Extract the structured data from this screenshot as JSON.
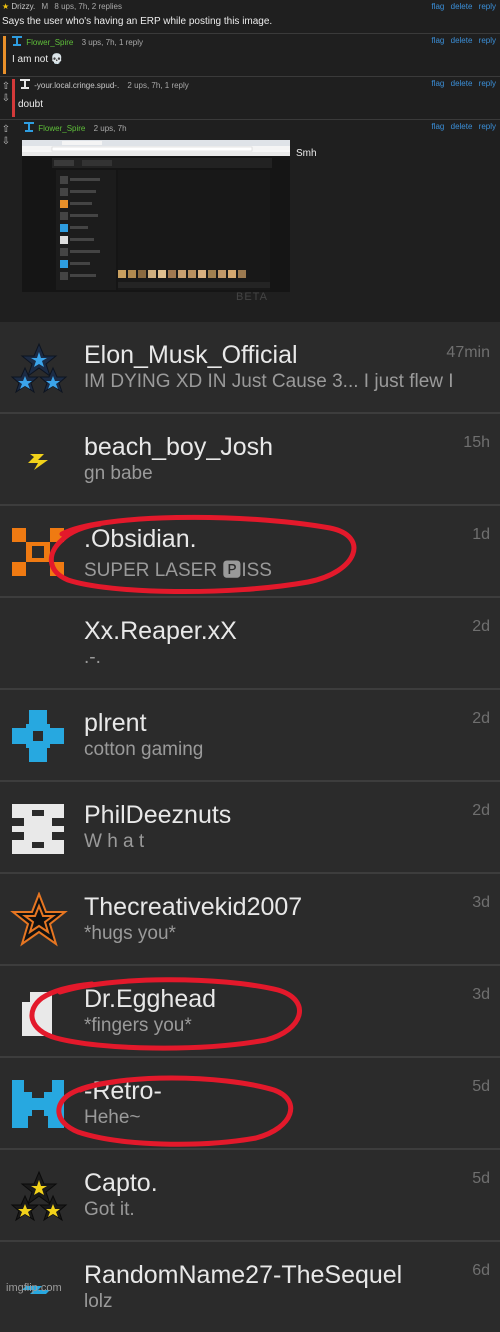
{
  "comments": [
    {
      "user": "Drizzy.",
      "badge": "M",
      "stats": "8 ups, 7h, 2 replies",
      "text": "Says the user who's having an ERP while posting this image.",
      "actions": [
        "flag",
        "delete",
        "reply"
      ]
    },
    {
      "user": "Flower_Spire",
      "stats": "3 ups, 7h, 1 reply",
      "text": "I am not 💀",
      "actions": [
        "flag",
        "delete",
        "reply"
      ],
      "accent": "#e8902a"
    },
    {
      "user": "-your.local.cringe.spud-.",
      "stats": "2 ups, 7h, 1 reply",
      "text": "doubt",
      "actions": [
        "flag",
        "delete",
        "reply"
      ],
      "accent": "#d33a3a"
    },
    {
      "user": "Flower_Spire",
      "stats": "2 ups, 7h",
      "text": "Smh",
      "actions": [
        "flag",
        "delete",
        "reply"
      ]
    }
  ],
  "screenshot": {
    "beta": "BETA"
  },
  "messages": [
    {
      "name": "Elon_Musk_Official",
      "preview": "IM DYING XD IN Just Cause 3... I just flew I",
      "time": "47min",
      "icon": "three-stars-icon"
    },
    {
      "name": "beach_boy_Josh",
      "preview": "gn babe",
      "time": "15h",
      "icon": "lightning-icon"
    },
    {
      "name": ".Obsidian.",
      "preview": "SUPER LASER 🅿ISS",
      "time": "1d",
      "icon": "orange-x-icon"
    },
    {
      "name": "Xx.Reaper.xX",
      "preview": ".-.",
      "time": "2d",
      "icon": ""
    },
    {
      "name": "plrent",
      "preview": "cotton gaming",
      "time": "2d",
      "icon": "blue-cross-icon"
    },
    {
      "name": "PhilDeeznuts",
      "preview": "W h a t",
      "time": "2d",
      "icon": "white-bars-icon"
    },
    {
      "name": "Thecreativekid2007",
      "preview": "*hugs you*",
      "time": "3d",
      "icon": "orange-star-icon"
    },
    {
      "name": "Dr.Egghead",
      "preview": "*fingers you*",
      "time": "3d",
      "icon": "white-block-icon"
    },
    {
      "name": "-Retro-",
      "preview": "Hehe~",
      "time": "5d",
      "icon": "blue-invader-icon"
    },
    {
      "name": "Capto.",
      "preview": "Got it.",
      "time": "5d",
      "icon": "yellow-stars-icon"
    },
    {
      "name": "RandomName27-TheSequel",
      "preview": "lolz",
      "time": "6d",
      "icon": "blue-dash-icon"
    }
  ],
  "watermark": "imgflip.com",
  "colors": {
    "link": "#3b8fd8",
    "username_green": "#5fbf3a",
    "annotation_red": "#e3192b"
  }
}
